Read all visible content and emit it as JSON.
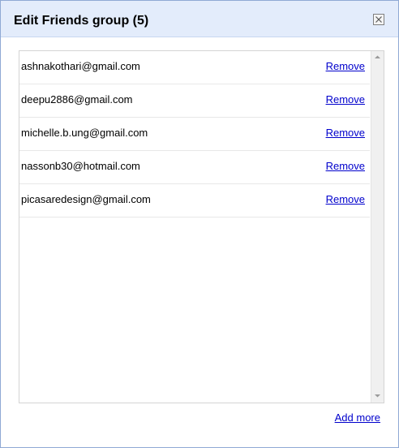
{
  "dialog": {
    "title": "Edit Friends group (5)"
  },
  "members": [
    {
      "email": "ashnakothari@gmail.com",
      "action": "Remove"
    },
    {
      "email": "deepu2886@gmail.com",
      "action": "Remove"
    },
    {
      "email": "michelle.b.ung@gmail.com",
      "action": "Remove"
    },
    {
      "email": "nassonb30@hotmail.com",
      "action": "Remove"
    },
    {
      "email": "picasaredesign@gmail.com",
      "action": "Remove"
    }
  ],
  "footer": {
    "add_more_label": "Add more"
  },
  "icons": {
    "close": "close-icon",
    "scroll_up": "scroll-up-arrow-icon",
    "scroll_down": "scroll-down-arrow-icon"
  },
  "colors": {
    "titlebar_background": "#e3ecfb",
    "dialog_border": "#8fa9d4",
    "link": "#0000cc"
  }
}
